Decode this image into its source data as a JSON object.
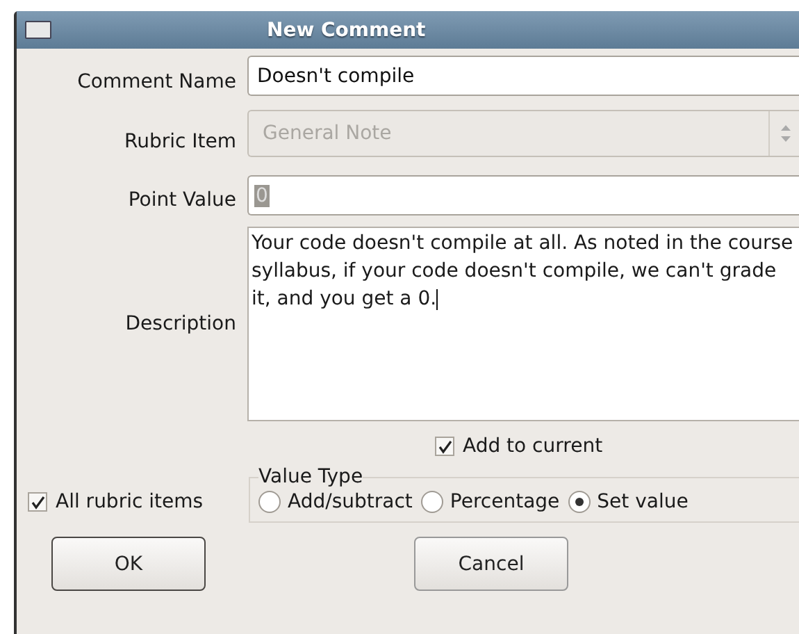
{
  "window": {
    "title": "New Comment"
  },
  "comment_name": {
    "label": "Comment Name",
    "value": "Doesn't compile"
  },
  "rubric_item": {
    "label": "Rubric Item",
    "value": "General Note",
    "disabled": true
  },
  "point_value": {
    "label": "Point Value",
    "value": "0"
  },
  "description": {
    "label": "Description",
    "value": "Your code doesn't compile at all.  As noted in the course syllabus, if your code doesn't compile, we can't grade it, and you get a 0."
  },
  "add_to_current": {
    "label": "Add to current",
    "checked": true
  },
  "all_rubric_items": {
    "label": "All rubric items",
    "checked": true
  },
  "value_type": {
    "title": "Value Type",
    "options": [
      {
        "label": "Add/subtract",
        "selected": false
      },
      {
        "label": "Percentage",
        "selected": false
      },
      {
        "label": "Set value",
        "selected": true
      }
    ]
  },
  "buttons": [
    "OK",
    "Cancel"
  ]
}
